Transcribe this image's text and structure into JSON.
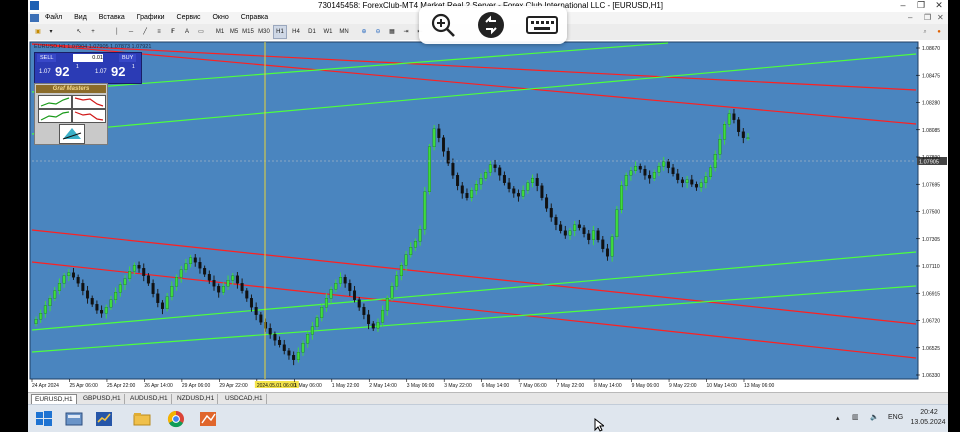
{
  "window": {
    "title": "730145458: ForexClub-MT4 Market Real 2 Server - Forex Club International LLC - [EURUSD,H1]",
    "controls": [
      "–",
      "❐",
      "✕"
    ]
  },
  "menu": [
    "Файл",
    "Вид",
    "Вставка",
    "Графики",
    "Сервис",
    "Окно",
    "Справка"
  ],
  "toolbar": {
    "timeframes": [
      "M1",
      "M5",
      "M15",
      "M30",
      "H1",
      "H4",
      "D1",
      "W1",
      "MN"
    ],
    "active_timeframe": "H1"
  },
  "chart_header": "EURUSD,H1  1.07904 1.07905 1.07873 1.07921",
  "trade_panel": {
    "sell_label": "SELL",
    "buy_label": "BUY",
    "lot": "0.01",
    "sell_big": "1.07",
    "sell_pips": "92",
    "sell_sup": "1",
    "buy_big": "1.07",
    "buy_pips": "92",
    "buy_sup": "1"
  },
  "grafmasters_label": "Graf Masters",
  "chart_data": {
    "type": "candlestick",
    "symbol": "EURUSD",
    "timeframe": "H1",
    "ylim": [
      1.06465,
      1.08685
    ],
    "current_price": 1.07905,
    "price_axis_labels": [
      "1.08670",
      "1.08475",
      "1.08280",
      "1.08085",
      "1.07890",
      "1.07695",
      "1.07500",
      "1.07305",
      "1.07110",
      "1.06915",
      "1.06720",
      "1.06525",
      "1.06330"
    ],
    "time_axis_labels": [
      "24 Apr 2024",
      "25 Apr 06:00",
      "25 Apr 22:00",
      "26 Apr 14:00",
      "29 Apr 06:00",
      "29 Apr 22:00",
      "2024.05.01 06:00",
      "1 May 06:00",
      "1 May 22:00",
      "2 May 14:00",
      "3 May 06:00",
      "3 May 22:00",
      "6 May 14:00",
      "7 May 06:00",
      "7 May 22:00",
      "8 May 14:00",
      "9 May 06:00",
      "9 May 22:00",
      "10 May 14:00",
      "13 May 06:00"
    ],
    "close_series": [
      1.0685,
      1.0689,
      1.0694,
      1.0699,
      1.0704,
      1.0709,
      1.0714,
      1.0716,
      1.0713,
      1.0709,
      1.0704,
      1.0699,
      1.0695,
      1.0691,
      1.0689,
      1.0693,
      1.0698,
      1.0703,
      1.0708,
      1.0712,
      1.0717,
      1.0721,
      1.0719,
      1.0714,
      1.0709,
      1.0702,
      1.0696,
      1.0692,
      1.07,
      1.0707,
      1.0713,
      1.0718,
      1.0722,
      1.0726,
      1.0723,
      1.0719,
      1.0715,
      1.0711,
      1.0707,
      1.0703,
      1.0707,
      1.0711,
      1.0714,
      1.0709,
      1.0704,
      1.0699,
      1.0693,
      1.0688,
      1.0683,
      1.0679,
      1.0675,
      1.0671,
      1.0668,
      1.0664,
      1.0661,
      1.0658,
      1.0663,
      1.0669,
      1.0675,
      1.068,
      1.0686,
      1.0693,
      1.0699,
      1.0705,
      1.0709,
      1.0713,
      1.0709,
      1.0704,
      1.0698,
      1.0693,
      1.0688,
      1.0682,
      1.0679,
      1.0683,
      1.0691,
      1.0699,
      1.0707,
      1.0714,
      1.0721,
      1.0728,
      1.0733,
      1.0737,
      1.0745,
      1.077,
      1.08,
      1.0812,
      1.0806,
      1.0797,
      1.0789,
      1.0781,
      1.0774,
      1.0769,
      1.0766,
      1.0771,
      1.0775,
      1.0779,
      1.0783,
      1.0788,
      1.0786,
      1.0781,
      1.0776,
      1.0772,
      1.0769,
      1.0767,
      1.0771,
      1.0776,
      1.0779,
      1.0774,
      1.0766,
      1.0759,
      1.0753,
      1.0748,
      1.0744,
      1.0741,
      1.0744,
      1.0748,
      1.0746,
      1.0742,
      1.0738,
      1.0744,
      1.0738,
      1.0732,
      1.0727,
      1.074,
      1.0758,
      1.0774,
      1.0781,
      1.0784,
      1.0787,
      1.0785,
      1.0781,
      1.0779,
      1.0783,
      1.0787,
      1.079,
      1.0786,
      1.0782,
      1.0778,
      1.0776,
      1.0778,
      1.0775,
      1.0773,
      1.0776,
      1.078,
      1.0786,
      1.0795,
      1.0805,
      1.0815,
      1.0822,
      1.0818,
      1.081,
      1.0806,
      1.0806
    ]
  },
  "tabs": [
    "EURUSD,H1",
    "GBPUSD,H1",
    "AUDUSD,H1",
    "NZDUSD,H1",
    "USDCAD,H1"
  ],
  "active_tab": "EURUSD,H1",
  "taskbar": {
    "lang": "ENG",
    "time": "20:42",
    "date": "13.05.2024"
  }
}
